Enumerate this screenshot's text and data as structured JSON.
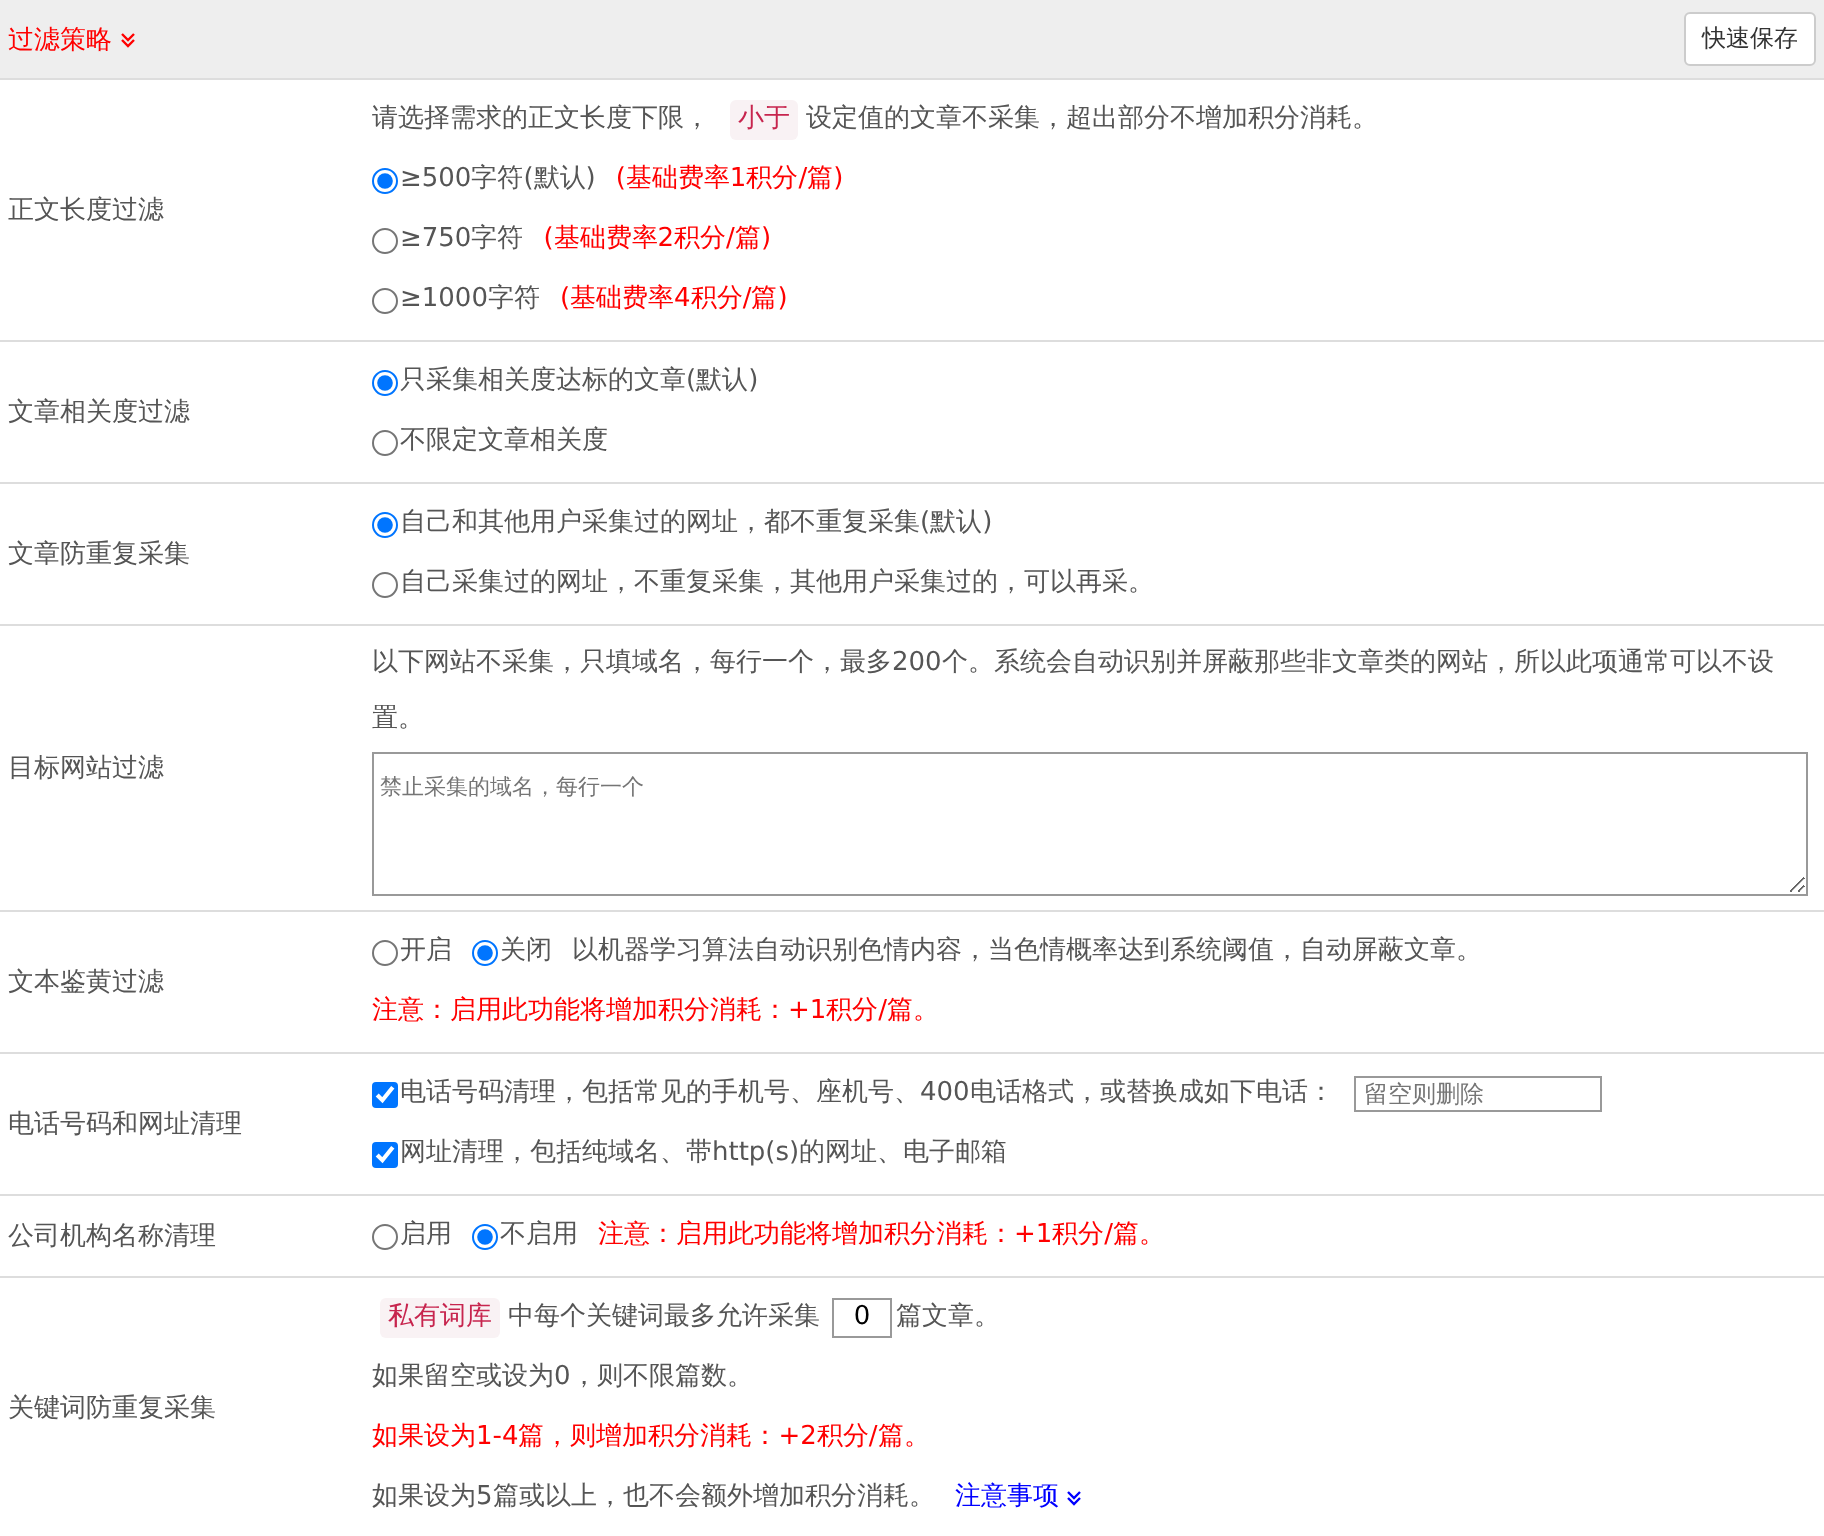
{
  "header": {
    "title": "过滤策略",
    "save_button": "快速保存"
  },
  "rows": [
    {
      "label": "正文长度过滤",
      "lines": [
        [
          {
            "kind": "text",
            "text": "请选择需求的正文长度下限，"
          },
          {
            "kind": "tag",
            "text": "小于"
          },
          {
            "kind": "text",
            "text": "设定值的文章不采集，超出部分不增加积分消耗。"
          }
        ],
        [
          {
            "kind": "radio",
            "label": "≥500字符(默认)",
            "selected": true
          },
          {
            "kind": "warning",
            "text": "(基础费率1积分/篇)"
          }
        ],
        [
          {
            "kind": "radio",
            "label": "≥750字符",
            "selected": false
          },
          {
            "kind": "warning",
            "text": "(基础费率2积分/篇)"
          }
        ],
        [
          {
            "kind": "radio",
            "label": "≥1000字符",
            "selected": false
          },
          {
            "kind": "warning",
            "text": "(基础费率4积分/篇)"
          }
        ]
      ]
    },
    {
      "label": "文章相关度过滤",
      "lines": [
        [
          {
            "kind": "radio",
            "label": "只采集相关度达标的文章(默认)",
            "selected": true
          }
        ],
        [
          {
            "kind": "radio",
            "label": "不限定文章相关度",
            "selected": false
          }
        ]
      ]
    },
    {
      "label": "文章防重复采集",
      "lines": [
        [
          {
            "kind": "radio",
            "label": "自己和其他用户采集过的网址，都不重复采集(默认)",
            "selected": true
          }
        ],
        [
          {
            "kind": "radio",
            "label": "自己采集过的网址，不重复采集，其他用户采集过的，可以再采。",
            "selected": false
          }
        ]
      ]
    },
    {
      "label": "目标网站过滤",
      "lines": [
        [
          {
            "kind": "text",
            "text": "以下网站不采集，只填域名，每行一个，最多200个。系统会自动识别并屏蔽那些非文章类的网站，所以此项通常可以不设置。"
          }
        ],
        [
          {
            "kind": "textarea",
            "placeholder": "禁止采集的域名，每行一个"
          }
        ]
      ]
    },
    {
      "label": "文本鉴黄过滤",
      "lines": [
        [
          {
            "kind": "radio",
            "label": "开启",
            "selected": false
          },
          {
            "kind": "radio",
            "label": "关闭",
            "selected": true
          },
          {
            "kind": "text",
            "text": "以机器学习算法自动识别色情内容，当色情概率达到系统阈值，自动屏蔽文章。"
          }
        ],
        [
          {
            "kind": "warning",
            "text": "注意：启用此功能将增加积分消耗：+1积分/篇。"
          }
        ]
      ]
    },
    {
      "label": "电话号码和网址清理",
      "lines": [
        [
          {
            "kind": "checkbox",
            "label": "电话号码清理，包括常见的手机号、座机号、400电话格式，或替换成如下电话：",
            "checked": true
          },
          {
            "kind": "input",
            "placeholder": "留空则删除"
          }
        ],
        [
          {
            "kind": "checkbox",
            "label": "网址清理，包括纯域名、带http(s)的网址、电子邮箱",
            "checked": true
          }
        ]
      ]
    },
    {
      "label": "公司机构名称清理",
      "lines": [
        [
          {
            "kind": "radio",
            "label": "启用",
            "selected": false
          },
          {
            "kind": "radio",
            "label": "不启用",
            "selected": true
          },
          {
            "kind": "warning",
            "text": "注意：启用此功能将增加积分消耗：+1积分/篇。"
          }
        ]
      ]
    },
    {
      "label": "关键词防重复采集",
      "lines": [
        [
          {
            "kind": "tag",
            "text": "私有词库"
          },
          {
            "kind": "text",
            "text": "中每个关键词最多允许采集"
          },
          {
            "kind": "number",
            "value": "0"
          },
          {
            "kind": "text",
            "text": "篇文章。"
          }
        ],
        [
          {
            "kind": "text",
            "text": "如果留空或设为0，则不限篇数。"
          }
        ],
        [
          {
            "kind": "warning",
            "text": "如果设为1-4篇，则增加积分消耗：+2积分/篇。"
          }
        ],
        [
          {
            "kind": "text",
            "text": "如果设为5篇或以上，也不会额外增加积分消耗。"
          },
          {
            "kind": "link",
            "text": "注意事项"
          }
        ]
      ]
    }
  ]
}
